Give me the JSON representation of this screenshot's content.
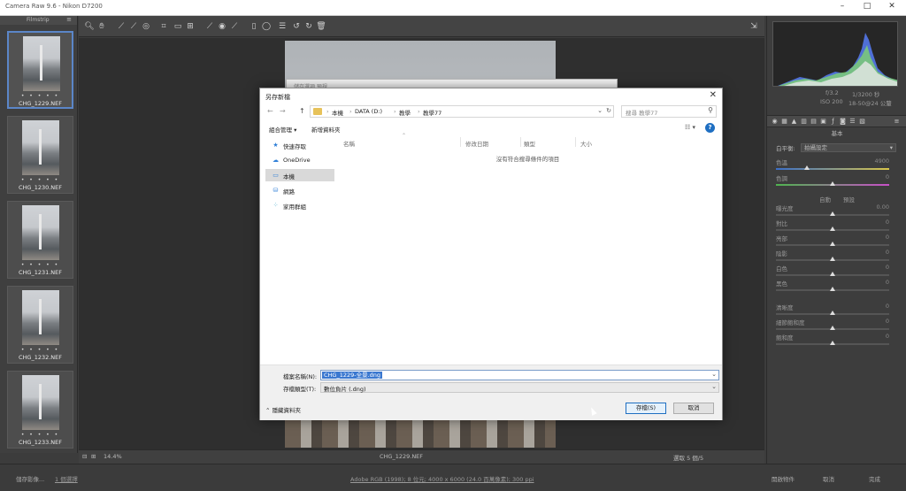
{
  "titlebar": {
    "title": "Camera Raw 9.6 - Nikon D7200",
    "minimize": "–",
    "maximize": "□",
    "close": "✕"
  },
  "filmstrip": {
    "header": "Filmstrip",
    "items": [
      {
        "name": "CHG_1229.NEF",
        "rating": "• • • • •"
      },
      {
        "name": "CHG_1230.NEF",
        "rating": "• • • • •"
      },
      {
        "name": "CHG_1231.NEF",
        "rating": "• • • • •"
      },
      {
        "name": "CHG_1232.NEF",
        "rating": "• • • • •"
      },
      {
        "name": "CHG_1233.NEF",
        "rating": "• • • • •"
      }
    ]
  },
  "canvas": {
    "zoom": "14.4%",
    "filename": "CHG_1229.NEF",
    "selected": "選取 5 個/5"
  },
  "right_panel": {
    "camera_info": {
      "f": "f/3.2",
      "shutter": "1/3200 秒",
      "iso": "ISO 200",
      "lens": "18-50@24 公釐"
    },
    "panel_title": "基本",
    "white_balance_label": "白平衡:",
    "white_balance_value": "拍攝設定",
    "auto": "自動",
    "default": "預設",
    "sliders": [
      {
        "label": "色溫",
        "value": "4900"
      },
      {
        "label": "色調",
        "value": "0"
      },
      {
        "label": "曝光度",
        "value": "0.00"
      },
      {
        "label": "對比",
        "value": "0"
      },
      {
        "label": "亮部",
        "value": "0"
      },
      {
        "label": "陰影",
        "value": "0"
      },
      {
        "label": "白色",
        "value": "0"
      },
      {
        "label": "黑色",
        "value": "0"
      },
      {
        "label": "清晰度",
        "value": "0"
      },
      {
        "label": "細節飽和度",
        "value": "0"
      },
      {
        "label": "飽和度",
        "value": "0"
      }
    ]
  },
  "bottombar": {
    "save_image": "儲存影像...",
    "select_all": "1 個選擇",
    "workflow": "Adobe RGB (1998); 8 位元; 4000 x 6000 (24.0 百萬像素); 300 ppi",
    "open_object": "開啟物件",
    "cancel": "取消",
    "done": "完成"
  },
  "ghost": {
    "text": "儲存選項 預視"
  },
  "dialog": {
    "title": "另存新檔",
    "close": "✕",
    "back": "←",
    "forward": "→",
    "up": "↑",
    "path": [
      "本機",
      "DATA (D:)",
      "教學",
      "教學77"
    ],
    "refresh": "↻",
    "search_placeholder": "搜尋 教學77",
    "organize": "組合管理 ▾",
    "new_folder": "新增資料夾",
    "view_icon": "☷ ▾",
    "help": "?",
    "nav": [
      {
        "label": "快速存取"
      },
      {
        "label": "OneDrive"
      },
      {
        "label": "本機"
      },
      {
        "label": "網路"
      },
      {
        "label": "家用群組"
      }
    ],
    "columns": {
      "name": "名稱",
      "date": "修改日期",
      "type": "類型",
      "size": "大小"
    },
    "empty_text": "沒有符合搜尋條件的項目",
    "filename_label": "檔案名稱(N):",
    "filename_value": "CHG_1229-全景.dng",
    "filetype_label": "存檔類型(T):",
    "filetype_value": "數位負片 (.dng)",
    "hide_folders": "隱藏資料夾",
    "save": "存檔(S)",
    "cancel": "取消"
  },
  "colors": {
    "accent": "#1f6fc2",
    "selection": "#3a78d0",
    "filmstrip_selected": "#5b86c8"
  }
}
